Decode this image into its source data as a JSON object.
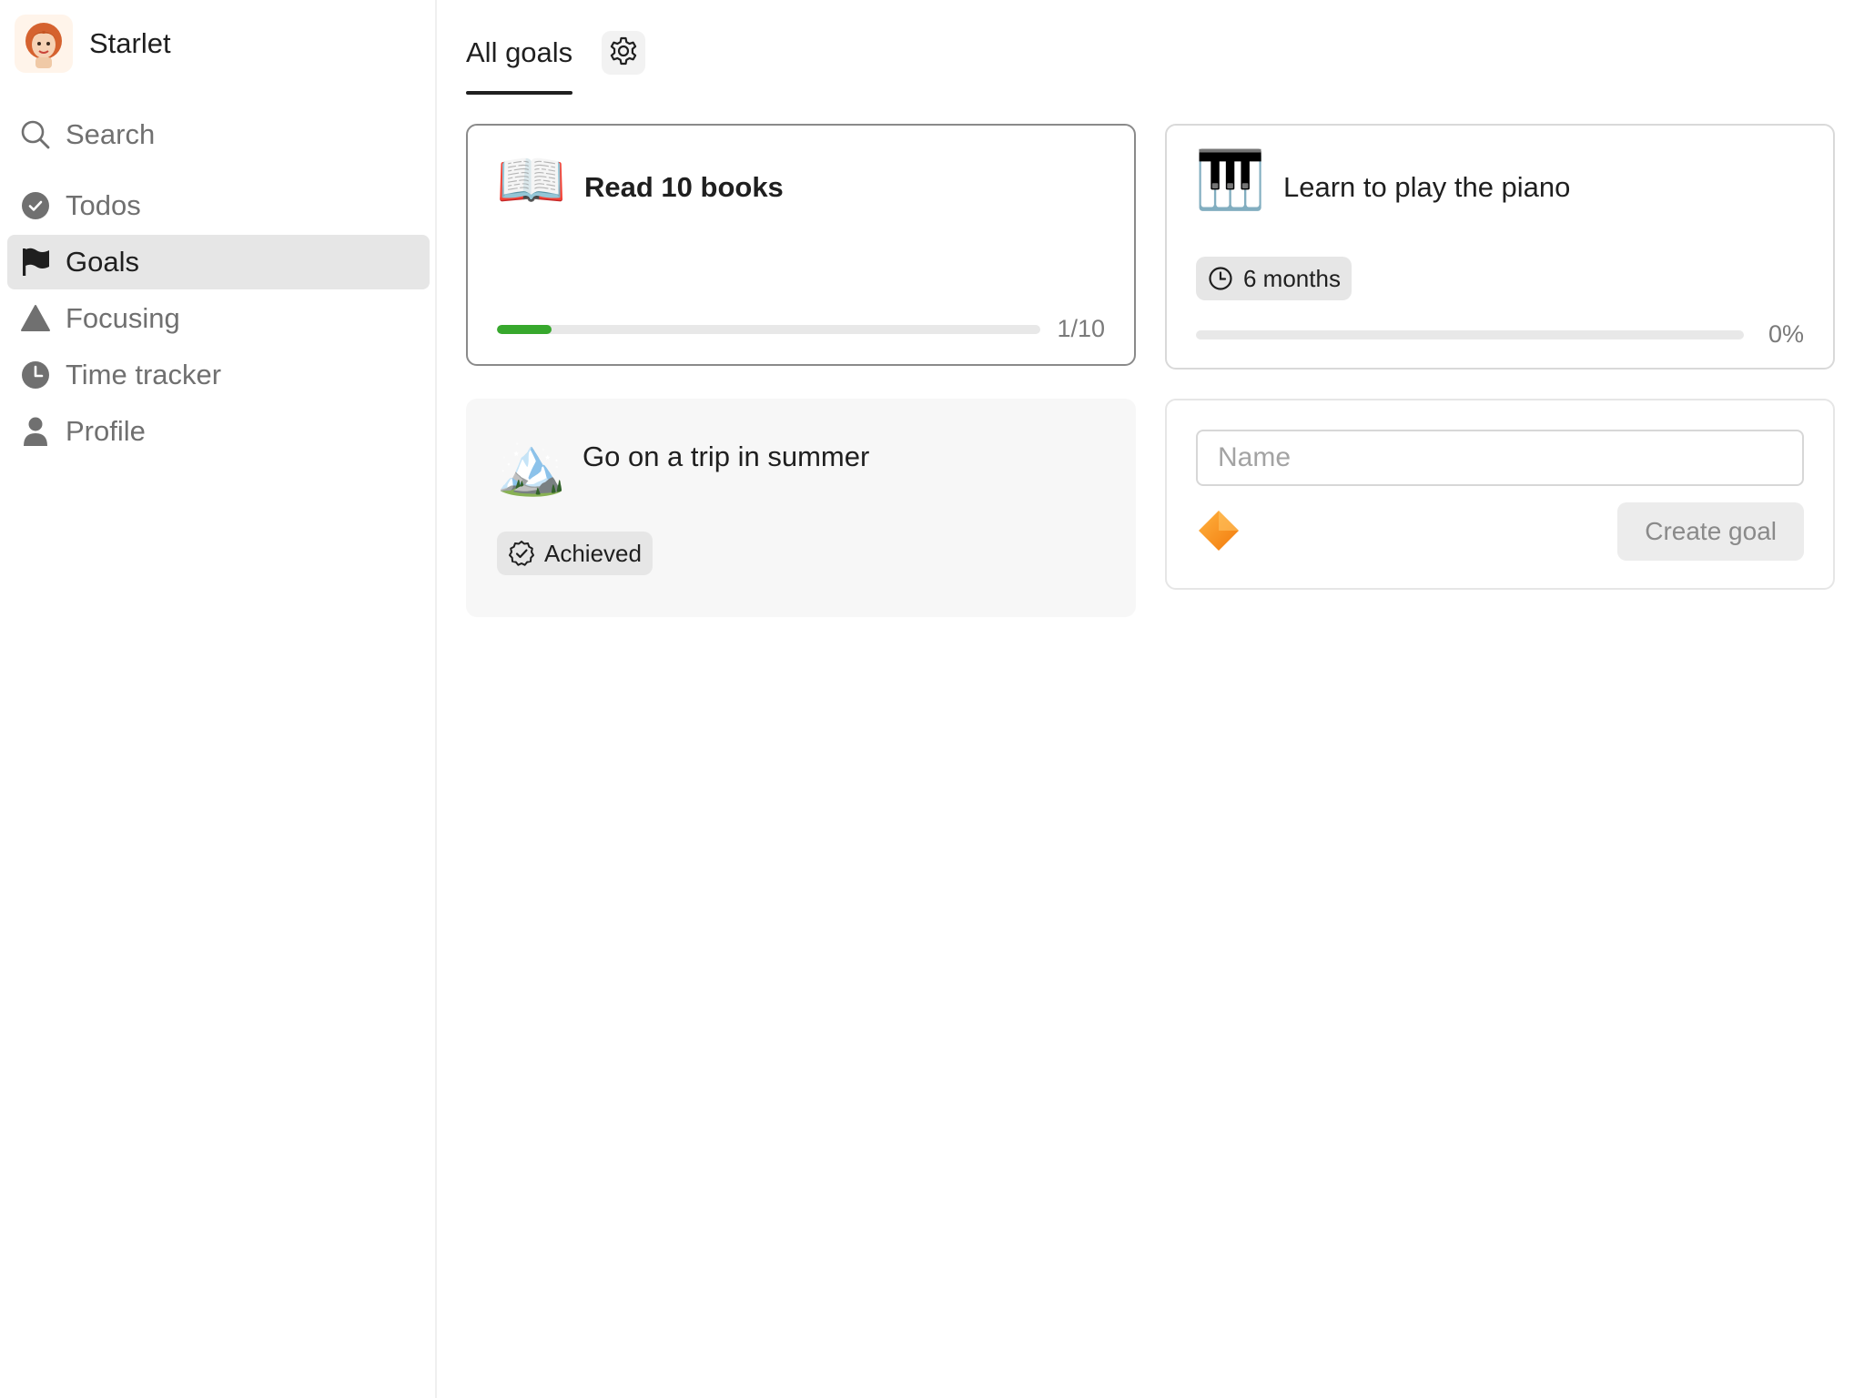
{
  "sidebar": {
    "brand": {
      "name": "Starlet",
      "avatar_icon": "girl-avatar-icon"
    },
    "search_label": "Search",
    "items": [
      {
        "label": "Todos",
        "icon": "check-circle-icon",
        "active": false
      },
      {
        "label": "Goals",
        "icon": "flag-icon",
        "active": true
      },
      {
        "label": "Focusing",
        "icon": "triangle-icon",
        "active": false
      },
      {
        "label": "Time tracker",
        "icon": "clock-icon",
        "active": false
      },
      {
        "label": "Profile",
        "icon": "person-icon",
        "active": false
      }
    ]
  },
  "header": {
    "tab_label": "All goals",
    "settings_icon": "gear-icon"
  },
  "goals": [
    {
      "title": "Read 10 books",
      "emoji": "📖",
      "progress_fraction": 0.1,
      "progress_label": "1/10"
    },
    {
      "title": "Learn to play the piano",
      "emoji": "🎹",
      "duration": "6 months",
      "progress_fraction": 0,
      "progress_label": "0%"
    },
    {
      "title": "Go on a trip in summer",
      "emoji": "🏔️",
      "status": "Achieved"
    }
  ],
  "new_goal": {
    "name_placeholder": "Name",
    "name_value": "",
    "emoji": "🔶",
    "create_label": "Create goal"
  },
  "colors": {
    "progress_green": "#37a82d",
    "active_nav_bg": "#e6e6e6",
    "muted_text": "#707070"
  }
}
